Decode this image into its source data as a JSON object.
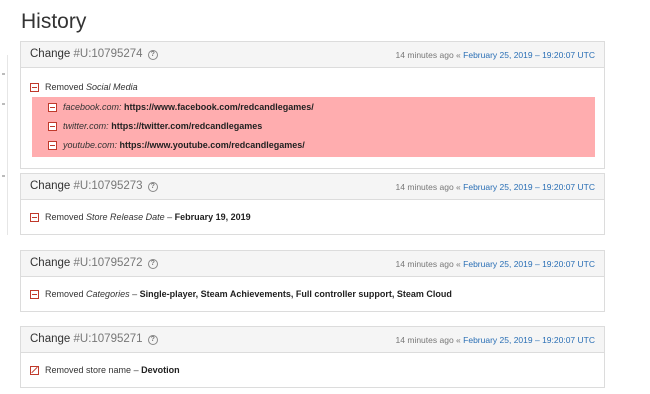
{
  "page": {
    "title": "History"
  },
  "cards": [
    {
      "label": "Change",
      "id": "#U:10795274",
      "ago": "14 minutes ago",
      "sep": "«",
      "date": "February 25, 2019 – 19:20:07 UTC",
      "action": "Removed",
      "field": "Social Media",
      "items": [
        {
          "key": "facebook.com:",
          "value": "https://www.facebook.com/redcandlegames/"
        },
        {
          "key": "twitter.com:",
          "value": "https://twitter.com/redcandlegames"
        },
        {
          "key": "youtube.com:",
          "value": "https://www.youtube.com/redcandlegames/"
        }
      ]
    },
    {
      "label": "Change",
      "id": "#U:10795273",
      "ago": "14 minutes ago",
      "sep": "«",
      "date": "February 25, 2019 – 19:20:07 UTC",
      "action": "Removed",
      "field": "Store Release Date",
      "dash": "–",
      "value": "February 19, 2019"
    },
    {
      "label": "Change",
      "id": "#U:10795272",
      "ago": "14 minutes ago",
      "sep": "«",
      "date": "February 25, 2019 – 19:20:07 UTC",
      "action": "Removed",
      "field": "Categories",
      "dash": "–",
      "value": "Single-player, Steam Achievements, Full controller support, Steam Cloud"
    },
    {
      "label": "Change",
      "id": "#U:10795271",
      "ago": "14 minutes ago",
      "sep": "«",
      "date": "February 25, 2019 – 19:20:07 UTC",
      "text": "Removed store name",
      "dash": "–",
      "value": "Devotion"
    }
  ],
  "icons": {
    "help": "question-circle-icon",
    "removed": "minus-square-icon",
    "edited": "edit-square-icon"
  },
  "colors": {
    "removed_bg": "#ffadaf",
    "link": "#2a6fb5",
    "icon_red": "#c0392b"
  }
}
